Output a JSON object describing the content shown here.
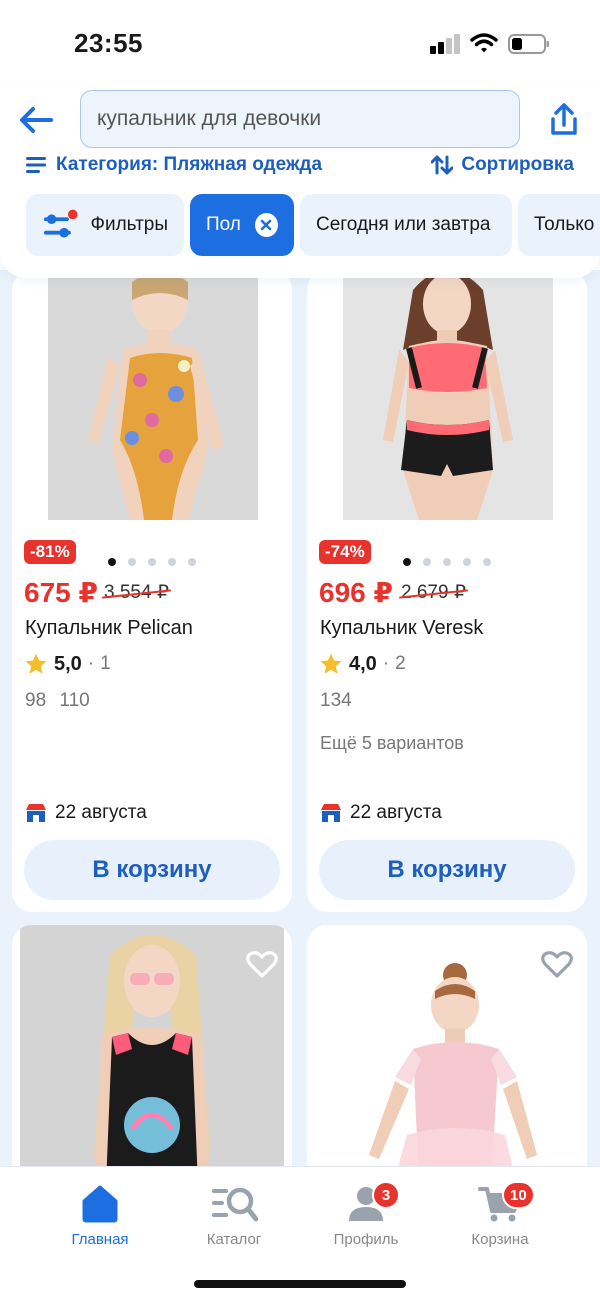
{
  "status_bar": {
    "time": "23:55"
  },
  "header": {
    "search": {
      "value": "купальник для девочки",
      "placeholder": ""
    },
    "category_label": "Категория: Пляжная одежда",
    "sort_label": "Сортировка"
  },
  "chips": [
    {
      "label": "Фильтры"
    },
    {
      "label": "Пол",
      "active": true
    },
    {
      "label": "Сегодня или завтра"
    },
    {
      "label": "Только"
    }
  ],
  "products": [
    {
      "discount": "-81%",
      "price": "675 ₽",
      "old_price": "3 554 ₽",
      "title": "Купальник Pelican",
      "rating": "5,0",
      "reviews": "1",
      "sizes": "98 110",
      "variants": "",
      "delivery": "22 августа",
      "cart_label": "В корзину"
    },
    {
      "discount": "-74%",
      "price": "696 ₽",
      "old_price": "2 679 ₽",
      "title": "Купальник Veresk",
      "rating": "4,0",
      "reviews": "2",
      "sizes": "134",
      "variants": "Ещё 5 вариантов",
      "delivery": "22 августа",
      "cart_label": "В корзину"
    }
  ],
  "bottom_nav": [
    {
      "label": "Главная",
      "icon": "home-icon",
      "active": true
    },
    {
      "label": "Каталог",
      "icon": "catalog-search-icon"
    },
    {
      "label": "Профиль",
      "icon": "profile-icon",
      "badge": "3"
    },
    {
      "label": "Корзина",
      "icon": "cart-icon",
      "badge": "10"
    }
  ],
  "colors": {
    "accent": "#1d6ee0",
    "link": "#1d5fbf",
    "sale": "#e8332c",
    "chip_bg": "#eaf2fb"
  }
}
